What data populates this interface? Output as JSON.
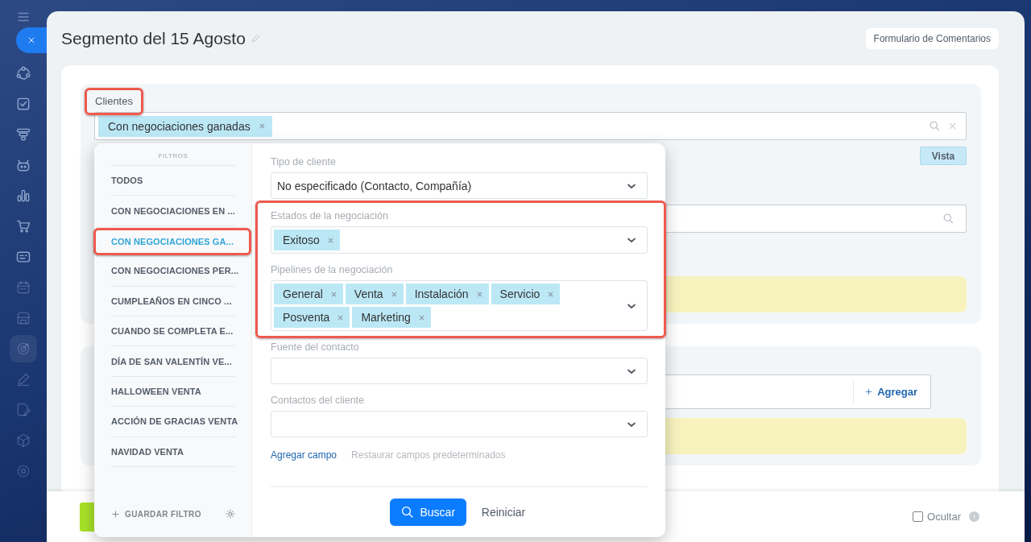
{
  "rail": {
    "items": [
      {
        "kind": "cycle",
        "selected": false
      },
      {
        "kind": "task",
        "selected": false
      },
      {
        "kind": "funnel",
        "selected": false
      },
      {
        "kind": "robot",
        "selected": false
      },
      {
        "kind": "chart",
        "selected": false
      },
      {
        "kind": "cart",
        "selected": false
      },
      {
        "kind": "card",
        "selected": false
      },
      {
        "kind": "calendar",
        "selected": false
      },
      {
        "kind": "store",
        "selected": false
      },
      {
        "kind": "target",
        "selected": true
      },
      {
        "kind": "pen",
        "selected": false
      },
      {
        "kind": "document",
        "selected": false
      },
      {
        "kind": "cube",
        "selected": false
      },
      {
        "kind": "gear",
        "selected": false
      }
    ]
  },
  "window": {
    "title": "Segmento del 15 Agosto"
  },
  "header_button": "Formulario de Comentarios",
  "clients_section": {
    "label": "Clientes",
    "highlighted": true,
    "tags": [
      "Con negociaciones ganadas"
    ],
    "preview_button": "Vista"
  },
  "second_section": {
    "add_button": "Agregar"
  },
  "footer": {
    "hide_checkbox": {
      "label": "Ocultar",
      "checked": false
    }
  },
  "filter_panel": {
    "heading": "FILTROS",
    "presets": [
      {
        "label": "TODOS",
        "selected": false,
        "highlighted": false
      },
      {
        "label": "CON NEGOCIACIONES EN ...",
        "selected": false,
        "highlighted": false
      },
      {
        "label": "CON NEGOCIACIONES GA...",
        "selected": true,
        "highlighted": true
      },
      {
        "label": "CON NEGOCIACIONES PER...",
        "selected": false,
        "highlighted": false
      },
      {
        "label": "CUMPLEAÑOS EN CINCO ...",
        "selected": false,
        "highlighted": false
      },
      {
        "label": "CUANDO SE COMPLETA E...",
        "selected": false,
        "highlighted": false
      },
      {
        "label": "DÍA DE SAN VALENTÍN VE...",
        "selected": false,
        "highlighted": false
      },
      {
        "label": "HALLOWEEN VENTA",
        "selected": false,
        "highlighted": false
      },
      {
        "label": "ACCIÓN DE GRACIAS VENTA",
        "selected": false,
        "highlighted": false
      },
      {
        "label": "NAVIDAD VENTA",
        "selected": false,
        "highlighted": false
      }
    ],
    "save_filter": "GUARDAR FILTRO",
    "fields": [
      {
        "label": "Tipo de cliente",
        "kind": "select",
        "value": "No especificado (Contacto, Compañía)",
        "highlighted": false
      },
      {
        "label": "Estados de la negociación",
        "kind": "tags",
        "tags": [
          "Exitoso"
        ],
        "highlighted": true
      },
      {
        "label": "Pipelines de la negociación",
        "kind": "tags",
        "tags": [
          "General",
          "Venta",
          "Instalación",
          "Servicio",
          "Posventa",
          "Marketing"
        ],
        "highlighted": true
      },
      {
        "label": "Fuente del contacto",
        "kind": "select",
        "highlighted": false
      },
      {
        "label": "Contactos del cliente",
        "kind": "select",
        "highlighted": false
      }
    ],
    "add_field_link": "Agregar campo",
    "restore_link": "Restaurar campos predeterminados",
    "search_button": "Buscar",
    "reset_button": "Reiniciar"
  }
}
